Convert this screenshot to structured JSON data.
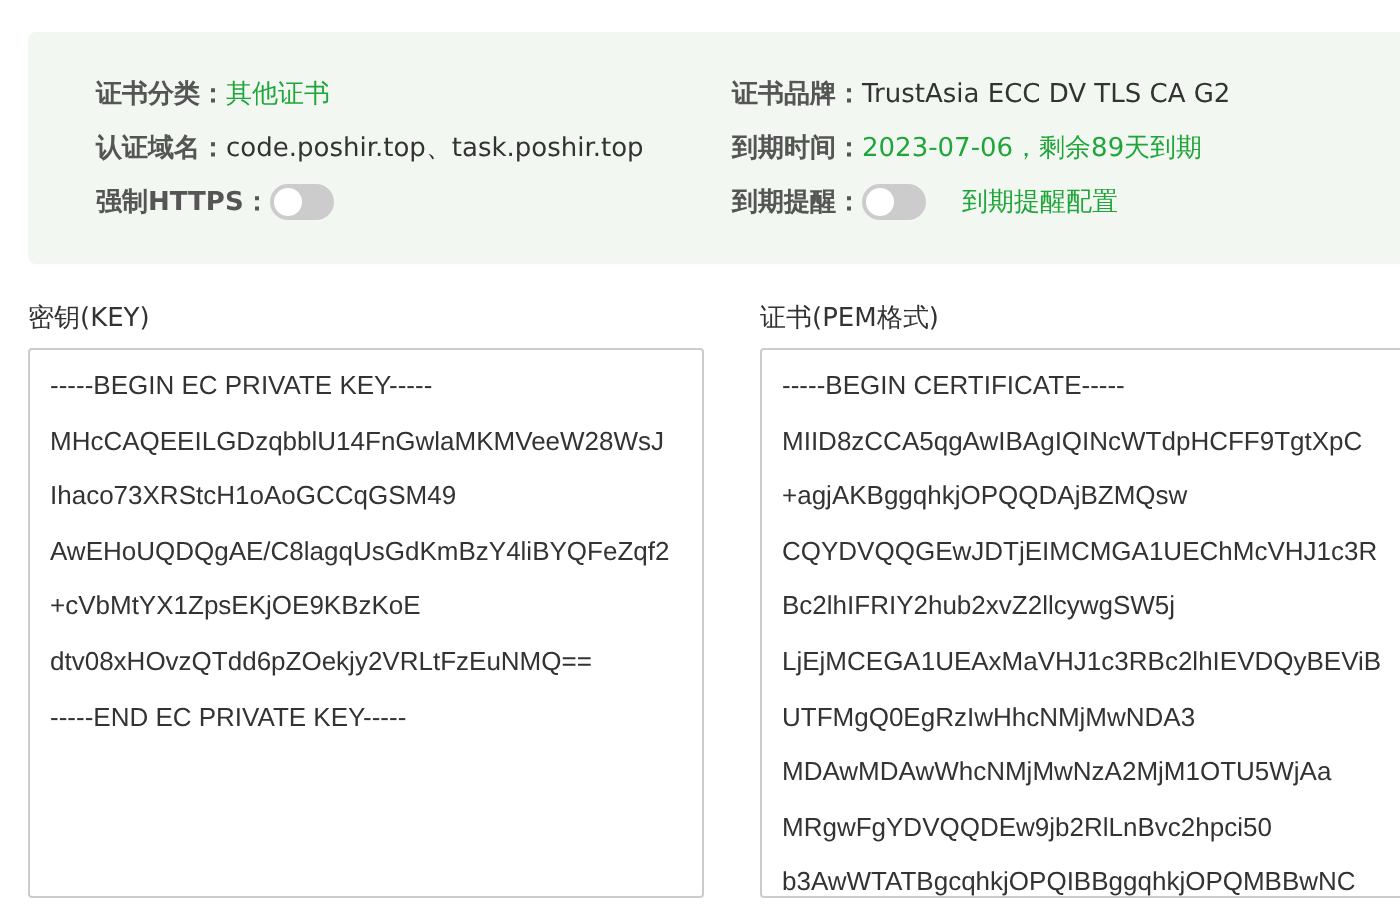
{
  "info": {
    "left": [
      {
        "kind": "text",
        "label": "证书分类：",
        "value": "其他证书",
        "highlight": true
      },
      {
        "kind": "text",
        "label": "认证域名：",
        "value": "code.poshir.top、task.poshir.top",
        "highlight": false
      },
      {
        "kind": "toggle",
        "label": "强制HTTPS：",
        "on": false
      }
    ],
    "right": [
      {
        "kind": "text",
        "label": "证书品牌：",
        "value": "TrustAsia ECC DV TLS CA G2",
        "highlight": false
      },
      {
        "kind": "text",
        "label": "到期时间：",
        "value": "2023-07-06，剩余89天到期",
        "highlight": true
      },
      {
        "kind": "toggle",
        "label": "到期提醒：",
        "on": false,
        "link": "到期提醒配置"
      }
    ]
  },
  "key": {
    "label": "密钥(KEY)",
    "lines": [
      "-----BEGIN EC PRIVATE KEY-----",
      "MHcCAQEEILGDzqbblU14FnGwlaMKMVeeW28WsJ",
      "Ihaco73XRStcH1oAoGCCqGSM49",
      "AwEHoUQDQgAE/C8lagqUsGdKmBzY4liBYQFeZqf2",
      "+cVbMtYX1ZpsEKjOE9KBzKoE",
      "dtv08xHOvzQTdd6pZOekjy2VRLtFzEuNMQ==",
      "-----END EC PRIVATE KEY-----"
    ]
  },
  "certificate": {
    "label": "证书(PEM格式)",
    "lines": [
      "-----BEGIN CERTIFICATE-----",
      "MIID8zCCA5qgAwIBAgIQINcWTdpHCFF9TgtXpC",
      "+agjAKBggqhkjOPQQDAjBZMQsw",
      "CQYDVQQGEwJDTjEIMCMGA1UEChMcVHJ1c3R",
      "Bc2lhIFRIY2hub2xvZ2llcywgSW5j",
      "LjEjMCEGA1UEAxMaVHJ1c3RBc2lhIEVDQyBEViB",
      "UTFMgQ0EgRzIwHhcNMjMwNDA3",
      "MDAwMDAwWhcNMjMwNzA2MjM1OTU5WjAa",
      "MRgwFgYDVQQDEw9jb2RlLnBvc2hpci50",
      "b3AwWTATBgcqhkjOPQIBBggqhkjOPQMBBwNC"
    ]
  }
}
